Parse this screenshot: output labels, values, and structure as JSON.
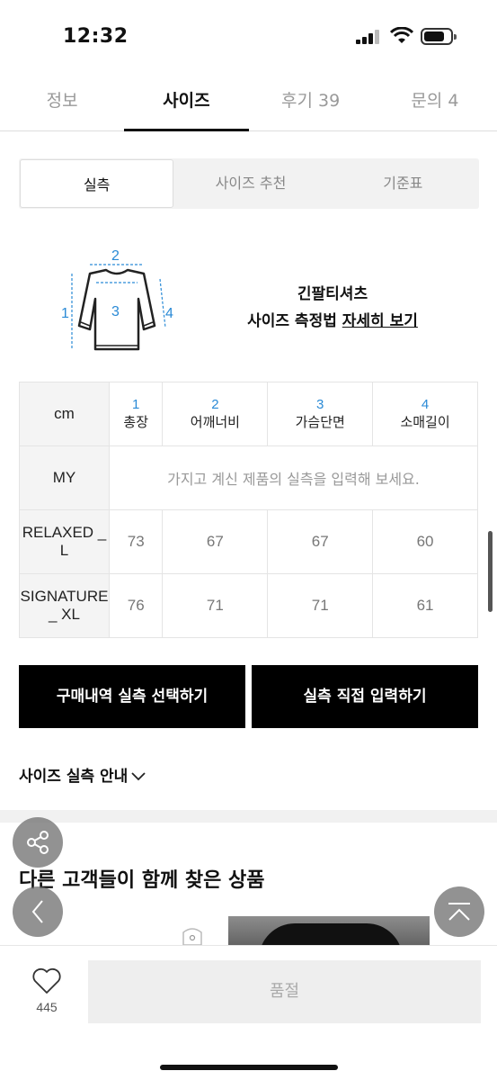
{
  "status": {
    "time": "12:32"
  },
  "tabs": [
    {
      "label": "정보",
      "active": false
    },
    {
      "label": "사이즈",
      "active": true
    },
    {
      "label": "후기 39",
      "active": false
    },
    {
      "label": "문의 4",
      "active": false
    }
  ],
  "segment": [
    {
      "label": "실측",
      "selected": true
    },
    {
      "label": "사이즈 추천",
      "selected": false
    },
    {
      "label": "기준표",
      "selected": false
    }
  ],
  "diagram": {
    "n1": "1",
    "n2": "2",
    "n3": "3",
    "n4": "4"
  },
  "description": {
    "line1": "긴팔티셔츠",
    "line2_prefix": "사이즈 측정법 ",
    "link": "자세히 보기"
  },
  "table": {
    "unit": "cm",
    "columns": [
      {
        "idx": "1",
        "name": "총장"
      },
      {
        "idx": "2",
        "name": "어깨너비"
      },
      {
        "idx": "3",
        "name": "가슴단면"
      },
      {
        "idx": "4",
        "name": "소매길이"
      }
    ],
    "my_label": "MY",
    "my_placeholder": "가지고 계신 제품의 실측을 입력해 보세요.",
    "rows": [
      {
        "label": "RELAXED _ L",
        "values": [
          "73",
          "67",
          "67",
          "60"
        ]
      },
      {
        "label": "SIGNATURE _ XL",
        "values": [
          "76",
          "71",
          "71",
          "61"
        ]
      }
    ]
  },
  "buttons": {
    "purchase": "구매내역 실측 선택하기",
    "direct": "실측 직접 입력하기"
  },
  "guide": "사이즈 실측 안내",
  "recommend_title": "다른 고객들이 함께 찾은 상품",
  "bottom": {
    "like_count": "445",
    "soldout": "품절"
  },
  "colors": {
    "accent": "#2a8ad6",
    "primary": "#000000"
  }
}
